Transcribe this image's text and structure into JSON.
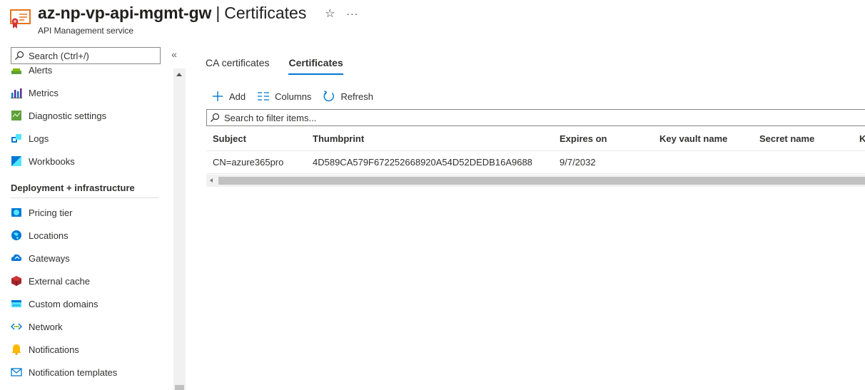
{
  "header": {
    "resource_name": "az-np-vp-api-mgmt-gw",
    "separator": "|",
    "page_title": "Certificates",
    "service_type": "API Management service",
    "star_icon": "star-icon",
    "more_label": "···"
  },
  "sidebar": {
    "search_placeholder": "Search (Ctrl+/)",
    "collapse_label": "«",
    "items_top": [
      {
        "label": "Alerts",
        "icon": "alerts-icon"
      },
      {
        "label": "Metrics",
        "icon": "metrics-icon"
      },
      {
        "label": "Diagnostic settings",
        "icon": "diagnostic-settings-icon"
      },
      {
        "label": "Logs",
        "icon": "logs-icon"
      },
      {
        "label": "Workbooks",
        "icon": "workbooks-icon"
      }
    ],
    "section_title": "Deployment + infrastructure",
    "items_deploy": [
      {
        "label": "Pricing tier",
        "icon": "pricing-tier-icon"
      },
      {
        "label": "Locations",
        "icon": "locations-icon"
      },
      {
        "label": "Gateways",
        "icon": "gateways-icon"
      },
      {
        "label": "External cache",
        "icon": "external-cache-icon"
      },
      {
        "label": "Custom domains",
        "icon": "custom-domains-icon"
      },
      {
        "label": "Network",
        "icon": "network-icon"
      },
      {
        "label": "Notifications",
        "icon": "notifications-icon"
      },
      {
        "label": "Notification templates",
        "icon": "notification-templates-icon"
      }
    ]
  },
  "main": {
    "tabs": [
      {
        "label": "CA certificates",
        "active": false
      },
      {
        "label": "Certificates",
        "active": true
      }
    ],
    "toolbar": {
      "add_label": "Add",
      "columns_label": "Columns",
      "refresh_label": "Refresh"
    },
    "filter_placeholder": "Search to filter items...",
    "table": {
      "columns": [
        "Subject",
        "Thumbprint",
        "Expires on",
        "Key vault name",
        "Secret name",
        "K"
      ],
      "rows": [
        [
          "CN=azure365pro",
          "4D589CA579F672252668920A54D52DEDB16A9688",
          "9/7/2032",
          "",
          "",
          ""
        ]
      ]
    }
  },
  "colors": {
    "accent": "#0078d4",
    "text": "#323130"
  }
}
